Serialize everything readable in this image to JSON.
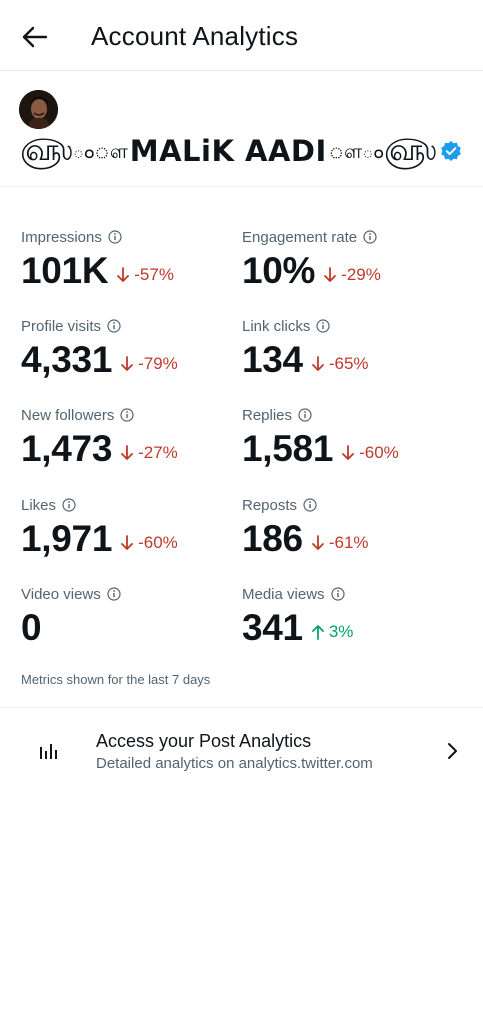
{
  "header": {
    "title": "Account Analytics",
    "back_icon": "arrow-left-icon"
  },
  "profile": {
    "display_name": "MALiK AADI",
    "deco_left_big": "௵",
    "deco_left_small": "ంௗ",
    "deco_right_small": "ௗం",
    "deco_right_big": "௵",
    "verified": true,
    "verified_color": "#1d9bf0"
  },
  "metrics": [
    {
      "label": "Impressions",
      "value": "101K",
      "change": "-57%",
      "direction": "down"
    },
    {
      "label": "Engagement rate",
      "value": "10%",
      "change": "-29%",
      "direction": "down"
    },
    {
      "label": "Profile visits",
      "value": "4,331",
      "change": "-79%",
      "direction": "down"
    },
    {
      "label": "Link clicks",
      "value": "134",
      "change": "-65%",
      "direction": "down"
    },
    {
      "label": "New followers",
      "value": "1,473",
      "change": "-27%",
      "direction": "down"
    },
    {
      "label": "Replies",
      "value": "1,581",
      "change": "-60%",
      "direction": "down"
    },
    {
      "label": "Likes",
      "value": "1,971",
      "change": "-60%",
      "direction": "down"
    },
    {
      "label": "Reposts",
      "value": "186",
      "change": "-61%",
      "direction": "down"
    },
    {
      "label": "Video views",
      "value": "0",
      "change": "",
      "direction": "none"
    },
    {
      "label": "Media views",
      "value": "341",
      "change": "3%",
      "direction": "up"
    }
  ],
  "footnote": "Metrics shown for the last 7 days",
  "post_analytics": {
    "title": "Access your Post Analytics",
    "subtitle": "Detailed analytics on analytics.twitter.com",
    "icon": "bar-chart-icon",
    "chevron": "chevron-right-icon"
  },
  "colors": {
    "negative": "#c0392b",
    "positive": "#00a36c",
    "text_primary": "#0f1419",
    "text_secondary": "#536471"
  }
}
